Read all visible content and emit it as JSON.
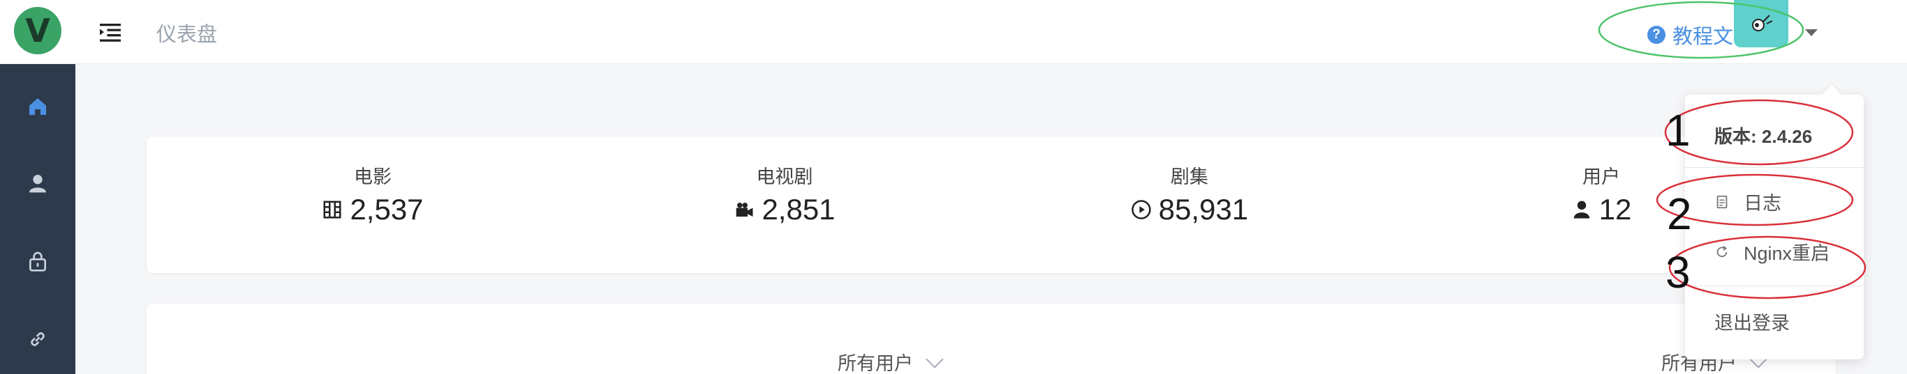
{
  "app": {
    "logo_letter": "V"
  },
  "header": {
    "page_title": "仪表盘",
    "docs_label": "教程文档",
    "docs_icon": "question-circle-icon"
  },
  "sidebar": {
    "items": [
      {
        "icon": "home-icon",
        "active": true
      },
      {
        "icon": "user-icon",
        "active": false
      },
      {
        "icon": "lock-icon",
        "active": false
      },
      {
        "icon": "link-icon",
        "active": false
      }
    ]
  },
  "stats": [
    {
      "label": "电影",
      "value": "2,537",
      "icon": "film-icon"
    },
    {
      "label": "电视剧",
      "value": "2,851",
      "icon": "video-camera-icon"
    },
    {
      "label": "剧集",
      "value": "85,931",
      "icon": "play-circle-icon"
    },
    {
      "label": "用户",
      "value": "12",
      "icon": "user-icon"
    }
  ],
  "filters": [
    {
      "label": "所有用户"
    },
    {
      "label": "所有用户"
    }
  ],
  "user_menu": {
    "version": "版本: 2.4.26",
    "items": [
      {
        "label": "日志",
        "icon": "document-icon"
      },
      {
        "label": "Nginx重启",
        "icon": "refresh-icon"
      },
      {
        "label": "退出登录"
      }
    ]
  },
  "annotations": {
    "numbers": [
      "1",
      "2",
      "3"
    ],
    "red": "#d9303a",
    "green": "#4cc36a"
  },
  "colors": {
    "accent": "#4a90e2",
    "sidebar_bg": "#2d3a4b",
    "logo_green": "#3aa366",
    "avatar_bg": "#5fd0cc"
  }
}
